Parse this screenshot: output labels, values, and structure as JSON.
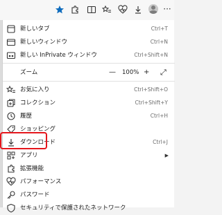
{
  "toolbar": {
    "icons": [
      "star-icon",
      "extensions-icon",
      "split-screen-icon",
      "favorites-icon",
      "health-icon",
      "download-icon",
      "profile-icon",
      "more-icon"
    ],
    "more_label": "···"
  },
  "menu": {
    "new_tab": {
      "label": "新しいタブ",
      "shortcut": "Ctrl+T"
    },
    "new_window": {
      "label": "新しいウィンドウ",
      "shortcut": "Ctrl+N"
    },
    "new_inprivate": {
      "label": "新しい InPrivate ウィンドウ",
      "shortcut": "Ctrl+Shift+N"
    },
    "zoom": {
      "label": "ズーム",
      "minus": "—",
      "value": "100%",
      "plus": "+",
      "fullscreen": "⤢"
    },
    "favorites": {
      "label": "お気に入り",
      "shortcut": "Ctrl+Shift+O"
    },
    "collections": {
      "label": "コレクション",
      "shortcut": "Ctrl+Shift+Y"
    },
    "history": {
      "label": "履歴",
      "shortcut": "Ctrl+H"
    },
    "shopping": {
      "label": "ショッピング",
      "shortcut": ""
    },
    "downloads": {
      "label": "ダウンロード",
      "shortcut": "Ctrl+J"
    },
    "apps": {
      "label": "アプリ",
      "arrow": "▶"
    },
    "extensions": {
      "label": "拡張機能"
    },
    "performance": {
      "label": "パフォーマンス"
    },
    "passwords": {
      "label": "パスワード"
    },
    "secure_network": {
      "label": "セキュリティで保護されたネットワーク"
    }
  },
  "colors": {
    "accent": "#0f6cbd",
    "highlight": "#e5151b"
  }
}
